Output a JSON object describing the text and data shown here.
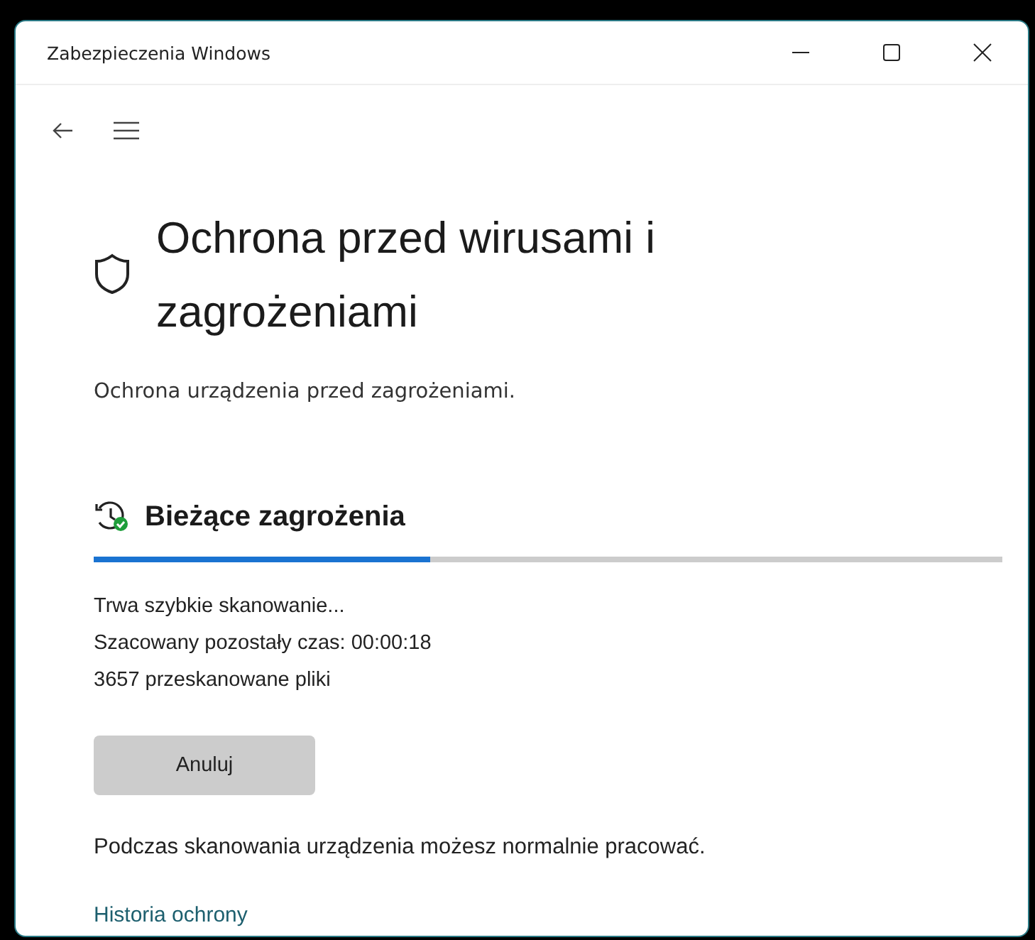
{
  "window": {
    "title": "Zabezpieczenia Windows"
  },
  "page": {
    "title": "Ochrona przed wirusami i zagrożeniami",
    "subtitle": "Ochrona urządzenia przed zagrożeniami."
  },
  "section": {
    "heading": "Bieżące zagrożenia",
    "progress": {
      "level": 0.37
    },
    "status_lines": [
      "Trwa szybkie skanowanie...",
      "Szacowany pozostały czas: 00:00:18",
      "3657 przeskanowane pliki"
    ],
    "cancel_button": "Anuluj",
    "note": "Podczas skanowania urządzenia możesz normalnie pracować.",
    "link": "Historia ochrony"
  }
}
